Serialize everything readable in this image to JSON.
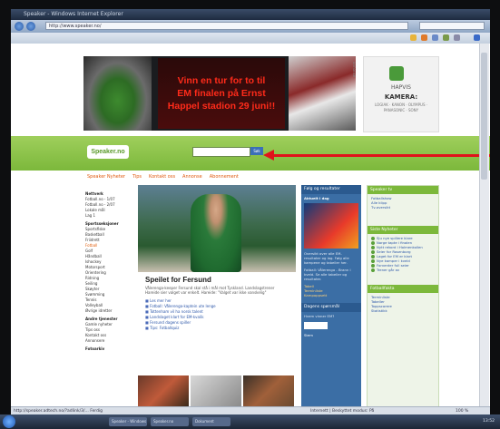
{
  "browser": {
    "title": "Speaker - Windows Internet Explorer",
    "url": "http://www.speaker.no/",
    "status_text": "http://speaker.adtech.no/?adlink/3/... Ferdig",
    "zone_text": "Internett | Beskyttet modus: På",
    "zoom": "100 %"
  },
  "banner": {
    "line1": "Vinn en tur for to til",
    "line2": "EM finalen på Ernst",
    "line3": "Happel stadion 29 juni!!"
  },
  "side_ad": {
    "brand": "HAPVIS",
    "headline": "KAMERA:",
    "small": "LOGIAK · KANON · OLYMPUS · PANASONIC · SONY"
  },
  "header": {
    "logo": "Speaker.no",
    "search_button": "Søk",
    "vertical_label": "annonse"
  },
  "nav": [
    "Speaker Nyheter",
    "Tips",
    "Kontakt oss",
    "Annonse",
    "Abonnement"
  ],
  "left_col": {
    "network_title": "Nettverk",
    "network": [
      "Fotball.no - 1/07",
      "Fotball.no - 2/07",
      "Lokale mål",
      "Lag 1"
    ],
    "sports_title": "Sportsseksjoner",
    "sports": [
      "Sportsfiske",
      "Basketball",
      "Friidrett",
      "Fotball",
      "Golf",
      "Håndball",
      "Ishockey",
      "Motorsport",
      "Orientering",
      "Ridning",
      "Seiling",
      "Skøyter",
      "Svømming",
      "Tennis",
      "Volleyball",
      "Øvrige idretter"
    ],
    "services_title": "Andre tjenester",
    "services": [
      "Gamle nyheter",
      "Tips oss",
      "Kontakt oss",
      "Annonsere"
    ],
    "extra_title": "Fotoarkiv"
  },
  "article": {
    "title": "Speilet for Fersund",
    "text": "Vålerenga-keeper Fersund skal stå i mål mot Tyskland. Landslagstrener Hareide sier valget var enkelt. Hareide: \"Valget var ikke vanskelig\"",
    "links": [
      "Les mer her",
      "Fotball: Vålerenga-kaptein ute lenge",
      "Tottenham vil ha norsk talent",
      "Landslaget klart for EM-kvalik",
      "Fersund dagens spiller",
      "Tips: Fotballquiz"
    ]
  },
  "blue_col": {
    "header": "Følg og resultater",
    "subheader": "Aktuelt i dag",
    "text1": "Oversikt over alle EM-resultater og lag. Følg alle kampene og tabeller her.",
    "text2": "Fotball: Vålerenga - Brann i kveld. Se alle tabeller og resultater.",
    "links": [
      "Tabell",
      "Terminliste",
      "Kampoppsett"
    ],
    "poll_title": "Dagens spørsmål",
    "poll_text": "Hvem vinner EM?",
    "vote_label": "Stem"
  },
  "right_col": {
    "header1": "Speaker tv",
    "items1": [
      "Fotballshow",
      "Alle klipp",
      "Tv-oversikt"
    ],
    "header2": "Siste Nyheter",
    "items2": [
      "Sju nye spillere klare",
      "Norge tapte i finalen",
      "Nytt rekord i Holmenkollen",
      "Seier for Rosenborg",
      "Laget for EM er klart",
      "Nye kamper i kveld",
      "Forventer full seier",
      "Trener går av"
    ],
    "header3": "Fotballfakta",
    "items3": [
      "Terminliste",
      "Tabeller",
      "Toppscorere",
      "Statistikk"
    ]
  },
  "taskbar": {
    "tasks": [
      "Speaker - Windows",
      "Speaker.no",
      "Dokument"
    ],
    "clock": "13:52"
  },
  "colors": {
    "green_header": "#7cb83b",
    "arrow": "#e0131b",
    "banner_text": "#ff2b1a",
    "blue_column": "#3b6ea5"
  }
}
